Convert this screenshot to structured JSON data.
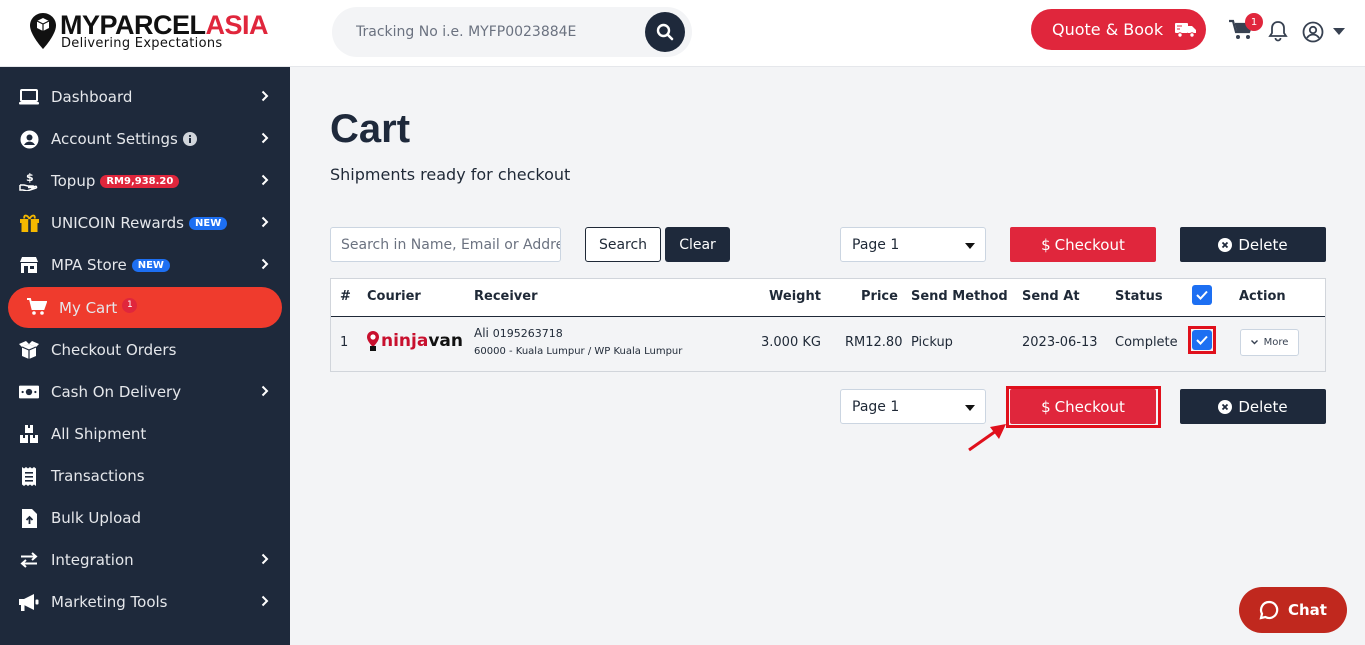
{
  "header": {
    "logo_primary": "MYPARCEL",
    "logo_accent": "ASIA",
    "logo_tagline": "Delivering Expectations",
    "tracking_placeholder": "Tracking No i.e. MYFP0023884E",
    "quote_label": "Quote & Book",
    "cart_count": "1"
  },
  "sidebar": {
    "items": [
      {
        "label": "Dashboard",
        "icon": "laptop-icon"
      },
      {
        "label": "Account Settings",
        "icon": "user-circle-icon"
      },
      {
        "label": "Topup",
        "badge": "RM9,938.20",
        "icon": "hand-dollar-icon"
      },
      {
        "label": "UNICOIN Rewards",
        "badge": "NEW",
        "icon": "gift-icon"
      },
      {
        "label": "MPA Store",
        "badge": "NEW",
        "icon": "store-icon"
      },
      {
        "label": "My Cart",
        "badge": "1",
        "icon": "cart-icon"
      },
      {
        "label": "Checkout Orders",
        "icon": "box-open-icon"
      },
      {
        "label": "Cash On Delivery",
        "icon": "money-bill-icon"
      },
      {
        "label": "All Shipment",
        "icon": "boxes-icon"
      },
      {
        "label": "Transactions",
        "icon": "receipt-icon"
      },
      {
        "label": "Bulk Upload",
        "icon": "file-upload-icon"
      },
      {
        "label": "Integration",
        "icon": "exchange-icon"
      },
      {
        "label": "Marketing Tools",
        "icon": "megaphone-icon"
      }
    ]
  },
  "main": {
    "title": "Cart",
    "subtitle": "Shipments ready for checkout",
    "filter_placeholder": "Search in Name, Email or Address",
    "search_label": "Search",
    "clear_label": "Clear",
    "page_label": "Page 1",
    "checkout_label": "Checkout",
    "delete_label": "Delete"
  },
  "table": {
    "headers": [
      "#",
      "Courier",
      "Receiver",
      "Weight",
      "Price",
      "Send Method",
      "Send At",
      "Status",
      "Action"
    ],
    "rows": [
      {
        "num": "1",
        "courier_a": "ninja",
        "courier_b": "van",
        "receiver_name": "Ali",
        "receiver_phone": "0195263718",
        "receiver_address": "60000 - Kuala Lumpur / WP Kuala Lumpur",
        "weight": "3.000 KG",
        "price": "RM12.80",
        "send_method": "Pickup",
        "send_at": "2023-06-13",
        "status": "Complete",
        "action": "More"
      }
    ]
  },
  "chat": {
    "label": "Chat"
  },
  "colors": {
    "brand_red": "#e0263c",
    "navy": "#1e293b",
    "active": "#ef3b2d",
    "blue": "#1d6ff2"
  }
}
